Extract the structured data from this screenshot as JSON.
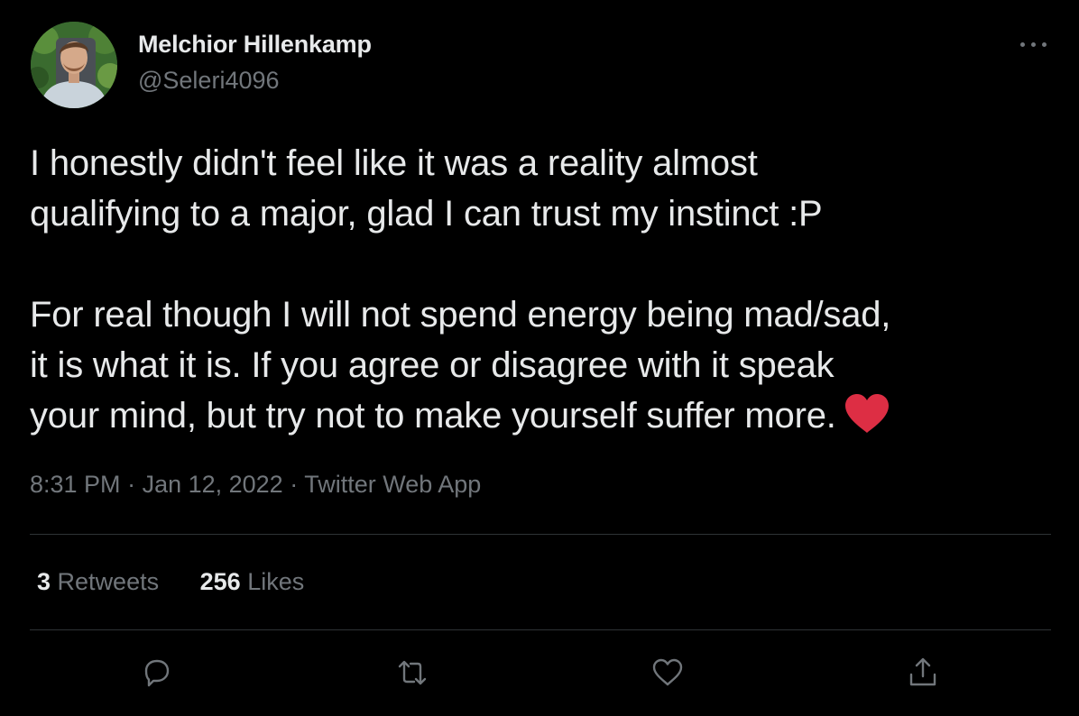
{
  "author": {
    "display_name": "Melchior Hillenkamp",
    "handle": "@Seleri4096"
  },
  "tweet": {
    "line1": "I honestly didn't feel like it was a reality almost",
    "line2": "qualifying to a major, glad I can trust my instinct :P",
    "line3": "For real though I will not spend energy being mad/sad,",
    "line4": "it is what it is. If you agree or disagree with it speak",
    "line5": "your mind, but try not to make yourself suffer more.",
    "emoji": "heart-emoji"
  },
  "meta": {
    "time": "8:31 PM",
    "date": "Jan 12, 2022",
    "source": "Twitter Web App",
    "separator": " · "
  },
  "stats": {
    "retweets_count": "3",
    "retweets_label": "Retweets",
    "likes_count": "256",
    "likes_label": "Likes"
  },
  "actions": [
    "reply-icon",
    "retweet-icon",
    "like-icon",
    "share-icon"
  ],
  "colors": {
    "background": "#000000",
    "text": "#e7e9ea",
    "muted": "#71767b",
    "divider": "#2f3336",
    "heart": "#e0245e"
  }
}
